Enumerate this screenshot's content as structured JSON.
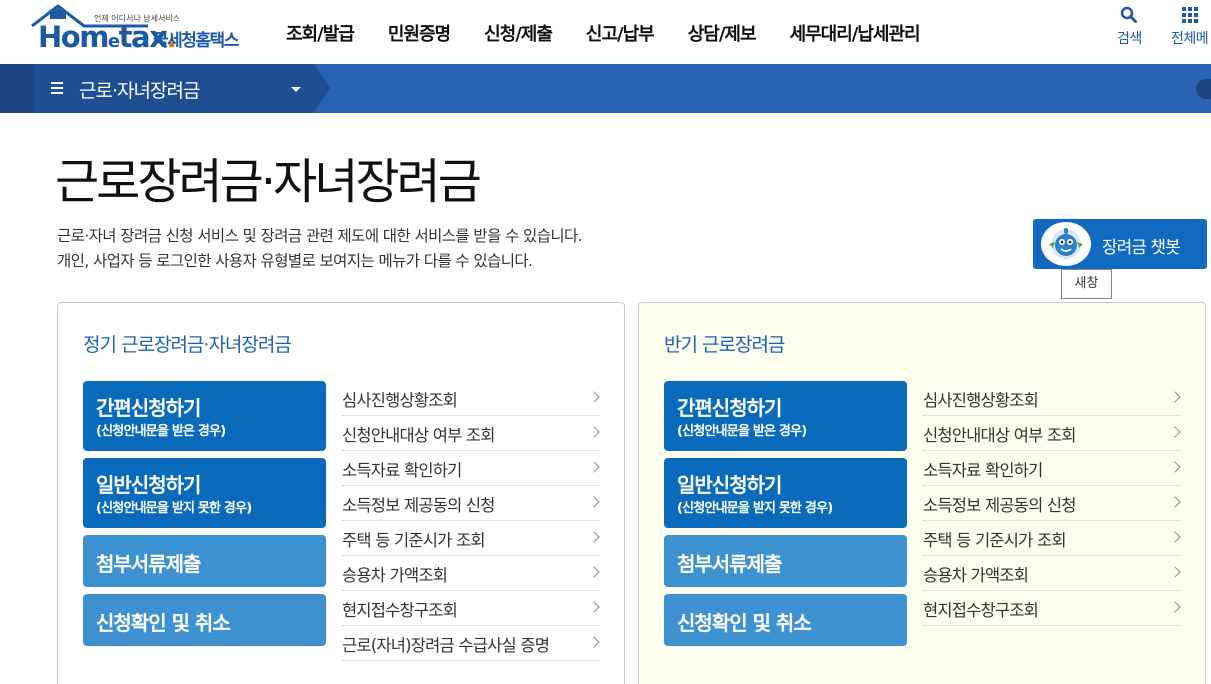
{
  "header": {
    "logo_sub": "언제 어디서나 납세서비스",
    "logo_main_a": "Hom",
    "logo_main_e": "e",
    "logo_main_b": "tax",
    "logo_dot": ".",
    "logo_kr": "국세청홈택스",
    "nav": [
      "조회/발급",
      "민원증명",
      "신청/제출",
      "신고/납부",
      "상담/제보",
      "세무대리/납세관리"
    ],
    "search_label": "검색",
    "all_menu_label": "전체메"
  },
  "subbar": {
    "title": "근로·자녀장려금"
  },
  "page": {
    "title": "근로장려금·자녀장려금",
    "desc_line1": "근로·자녀 장려금 신청 서비스 및 장려금 관련 제도에 대한 서비스를 받을 수 있습니다.",
    "desc_line2": "개인, 사업자 등 로그인한 사용자 유형별로 보여지는 메뉴가 다를 수 있습니다.",
    "chatbot_label": "장려금 챗봇",
    "newwin_label": "새창"
  },
  "panels": [
    {
      "title": "정기 근로장려금·자녀장려금",
      "buttons": [
        {
          "main": "간편신청하기",
          "sub": "(신청안내문을 받은 경우)"
        },
        {
          "main": "일반신청하기",
          "sub": "(신청안내문을 받지 못한 경우)"
        },
        {
          "main": "첨부서류제출",
          "sub": ""
        },
        {
          "main": "신청확인 및 취소",
          "sub": ""
        }
      ],
      "links": [
        "심사진행상황조회",
        "신청안내대상 여부 조회",
        "소득자료 확인하기",
        "소득정보 제공동의 신청",
        "주택 등 기준시가 조회",
        "승용차 가액조회",
        "현지접수창구조회",
        "근로(자녀)장려금 수급사실 증명"
      ]
    },
    {
      "title": "반기 근로장려금",
      "buttons": [
        {
          "main": "간편신청하기",
          "sub": "(신청안내문을 받은 경우)"
        },
        {
          "main": "일반신청하기",
          "sub": "(신청안내문을 받지 못한 경우)"
        },
        {
          "main": "첨부서류제출",
          "sub": ""
        },
        {
          "main": "신청확인 및 취소",
          "sub": ""
        }
      ],
      "links": [
        "심사진행상황조회",
        "신청안내대상 여부 조회",
        "소득자료 확인하기",
        "소득정보 제공동의 신청",
        "주택 등 기준시가 조회",
        "승용차 가액조회",
        "현지접수창구조회"
      ]
    }
  ],
  "colors": {
    "brand_blue": "#1d5aa5",
    "subbar_blue": "#2a62b4",
    "button_dark": "#0a6bbd",
    "button_light": "#3f92d2",
    "accent_orange": "#e37b17"
  }
}
